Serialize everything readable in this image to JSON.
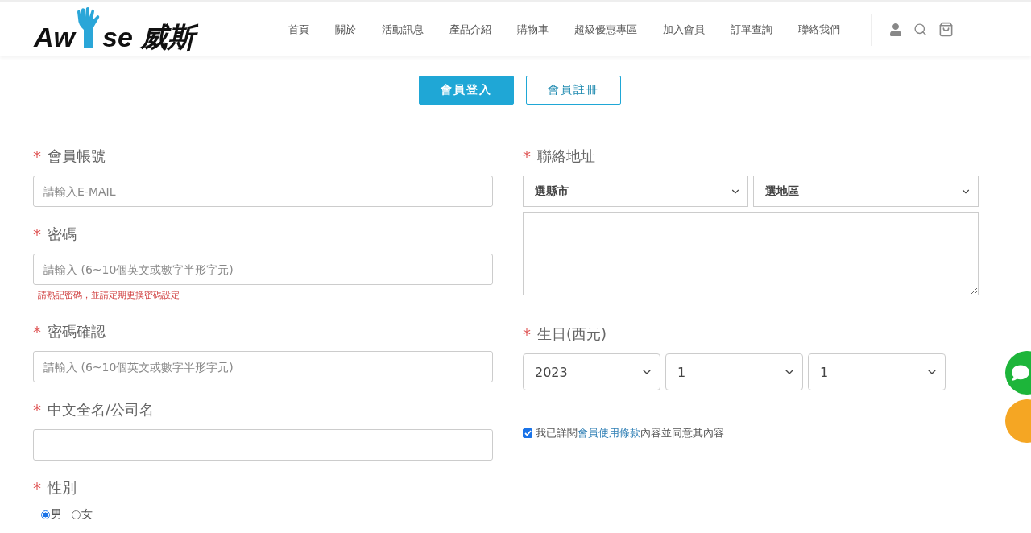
{
  "header": {
    "logo": {
      "before": "Aw",
      "after": "se 威斯"
    },
    "nav": [
      "首頁",
      "關於",
      "活動訊息",
      "產品介紹",
      "購物車",
      "超級優惠專區",
      "加入會員",
      "訂單查詢",
      "聯絡我們"
    ]
  },
  "tabs": [
    {
      "label": "會員登入",
      "selected": true
    },
    {
      "label": "會員註冊",
      "selected": false
    }
  ],
  "left": [
    {
      "label": "會員帳號",
      "marker": "*",
      "placeholder": "請輸入E-MAIL",
      "kind": "text"
    },
    {
      "label": "密碼",
      "marker": "*",
      "placeholder": "請輸入 (6~10個英文或數字半形字元)",
      "kind": "text",
      "hint": "請熟記密碼，並請定期更換密碼設定"
    },
    {
      "label": "密碼確認",
      "marker": "*",
      "placeholder": "請輸入 (6~10個英文或數字半形字元)",
      "kind": "text"
    },
    {
      "label": "中文全名/公司名",
      "marker": "*",
      "kind": "text"
    },
    {
      "label": "性別",
      "marker": "*",
      "kind": "radio",
      "options": [
        {
          "label": "男",
          "selected": true
        },
        {
          "label": "女",
          "selected": false
        }
      ]
    }
  ],
  "right": [
    {
      "label": "聯絡地址",
      "marker": "*",
      "kind": "address",
      "selects": [
        "選縣市",
        "選地區"
      ]
    },
    {
      "label": "生日(西元)",
      "marker": "*",
      "kind": "date",
      "selects": [
        "2023",
        "1",
        "1"
      ]
    }
  ],
  "agree": {
    "checked": true,
    "before": "我已詳閱",
    "link": "會員使用條款",
    "after": "內容並同意其內容"
  }
}
